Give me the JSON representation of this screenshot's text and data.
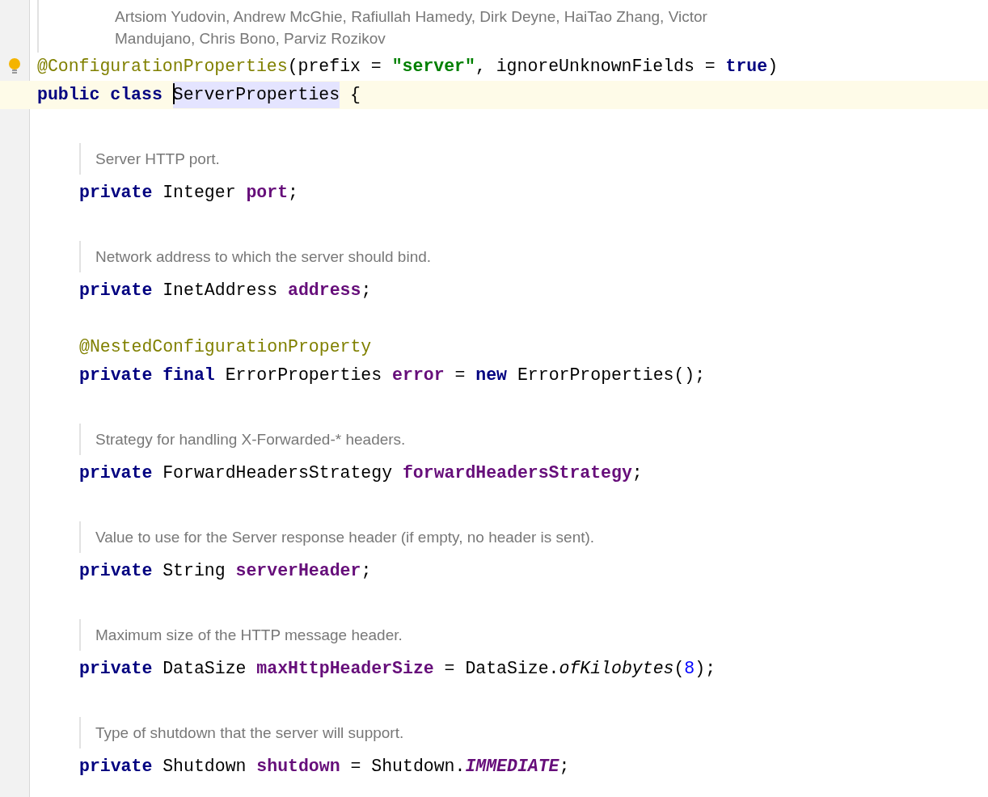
{
  "items": [
    {
      "kind": "doc",
      "outer": true,
      "lines": [
        "Artsiom Yudovin, Andrew McGhie, Rafiullah Hamedy, Dirk Deyne, HaiTao Zhang, Victor",
        "Mandujano, Chris Bono, Parviz Rozikov"
      ]
    },
    {
      "kind": "code",
      "indent": false,
      "current": false,
      "bulb": true,
      "tokens": [
        {
          "kind": "annotation",
          "text": "@ConfigurationProperties"
        },
        {
          "kind": "plain",
          "text": "(prefix = "
        },
        {
          "kind": "string",
          "text": "\"server\""
        },
        {
          "kind": "plain",
          "text": ", ignoreUnknownFields = "
        },
        {
          "kind": "keyword",
          "text": "true"
        },
        {
          "kind": "plain",
          "text": ")"
        }
      ]
    },
    {
      "kind": "code",
      "indent": false,
      "current": true,
      "bulb": false,
      "tokens": [
        {
          "kind": "keyword",
          "text": "public class "
        },
        {
          "kind": "plain",
          "text": "ServerProperties",
          "usage": true,
          "caret": true
        },
        {
          "kind": "plain",
          "text": " {"
        }
      ]
    },
    {
      "kind": "blank"
    },
    {
      "kind": "doc",
      "outer": false,
      "lines": [
        "Server HTTP port."
      ]
    },
    {
      "kind": "code",
      "indent": true,
      "current": false,
      "bulb": false,
      "tokens": [
        {
          "kind": "keyword",
          "text": "private "
        },
        {
          "kind": "plain",
          "text": "Integer "
        },
        {
          "kind": "field",
          "text": "port"
        },
        {
          "kind": "plain",
          "text": ";"
        }
      ]
    },
    {
      "kind": "blank"
    },
    {
      "kind": "doc",
      "outer": false,
      "lines": [
        "Network address to which the server should bind."
      ]
    },
    {
      "kind": "code",
      "indent": true,
      "current": false,
      "bulb": false,
      "tokens": [
        {
          "kind": "keyword",
          "text": "private "
        },
        {
          "kind": "plain",
          "text": "InetAddress "
        },
        {
          "kind": "field",
          "text": "address"
        },
        {
          "kind": "plain",
          "text": ";"
        }
      ]
    },
    {
      "kind": "blank"
    },
    {
      "kind": "code",
      "indent": true,
      "current": false,
      "bulb": false,
      "tokens": [
        {
          "kind": "annotation",
          "text": "@NestedConfigurationProperty"
        }
      ]
    },
    {
      "kind": "code",
      "indent": true,
      "current": false,
      "bulb": false,
      "tokens": [
        {
          "kind": "keyword",
          "text": "private final "
        },
        {
          "kind": "plain",
          "text": "ErrorProperties "
        },
        {
          "kind": "field",
          "text": "error"
        },
        {
          "kind": "plain",
          "text": " = "
        },
        {
          "kind": "keyword",
          "text": "new "
        },
        {
          "kind": "plain",
          "text": "ErrorProperties();"
        }
      ]
    },
    {
      "kind": "blank"
    },
    {
      "kind": "doc",
      "outer": false,
      "lines": [
        "Strategy for handling X-Forwarded-* headers."
      ]
    },
    {
      "kind": "code",
      "indent": true,
      "current": false,
      "bulb": false,
      "tokens": [
        {
          "kind": "keyword",
          "text": "private "
        },
        {
          "kind": "plain",
          "text": "ForwardHeadersStrategy "
        },
        {
          "kind": "field",
          "text": "forwardHeadersStrategy"
        },
        {
          "kind": "plain",
          "text": ";"
        }
      ]
    },
    {
      "kind": "blank"
    },
    {
      "kind": "doc",
      "outer": false,
      "lines": [
        "Value to use for the Server response header (if empty, no header is sent)."
      ]
    },
    {
      "kind": "code",
      "indent": true,
      "current": false,
      "bulb": false,
      "tokens": [
        {
          "kind": "keyword",
          "text": "private "
        },
        {
          "kind": "plain",
          "text": "String "
        },
        {
          "kind": "field",
          "text": "serverHeader"
        },
        {
          "kind": "plain",
          "text": ";"
        }
      ]
    },
    {
      "kind": "blank"
    },
    {
      "kind": "doc",
      "outer": false,
      "lines": [
        "Maximum size of the HTTP message header."
      ]
    },
    {
      "kind": "code",
      "indent": true,
      "current": false,
      "bulb": false,
      "tokens": [
        {
          "kind": "keyword",
          "text": "private "
        },
        {
          "kind": "plain",
          "text": "DataSize "
        },
        {
          "kind": "field",
          "text": "maxHttpHeaderSize"
        },
        {
          "kind": "plain",
          "text": " = DataSize."
        },
        {
          "kind": "method_static",
          "text": "ofKilobytes"
        },
        {
          "kind": "plain",
          "text": "("
        },
        {
          "kind": "number",
          "text": "8"
        },
        {
          "kind": "plain",
          "text": ");"
        }
      ]
    },
    {
      "kind": "blank"
    },
    {
      "kind": "doc",
      "outer": false,
      "lines": [
        "Type of shutdown that the server will support."
      ]
    },
    {
      "kind": "code",
      "indent": true,
      "current": false,
      "bulb": false,
      "tokens": [
        {
          "kind": "keyword",
          "text": "private "
        },
        {
          "kind": "plain",
          "text": "Shutdown "
        },
        {
          "kind": "field",
          "text": "shutdown"
        },
        {
          "kind": "plain",
          "text": " = Shutdown."
        },
        {
          "kind": "constant",
          "text": "IMMEDIATE"
        },
        {
          "kind": "plain",
          "text": ";"
        }
      ]
    }
  ]
}
